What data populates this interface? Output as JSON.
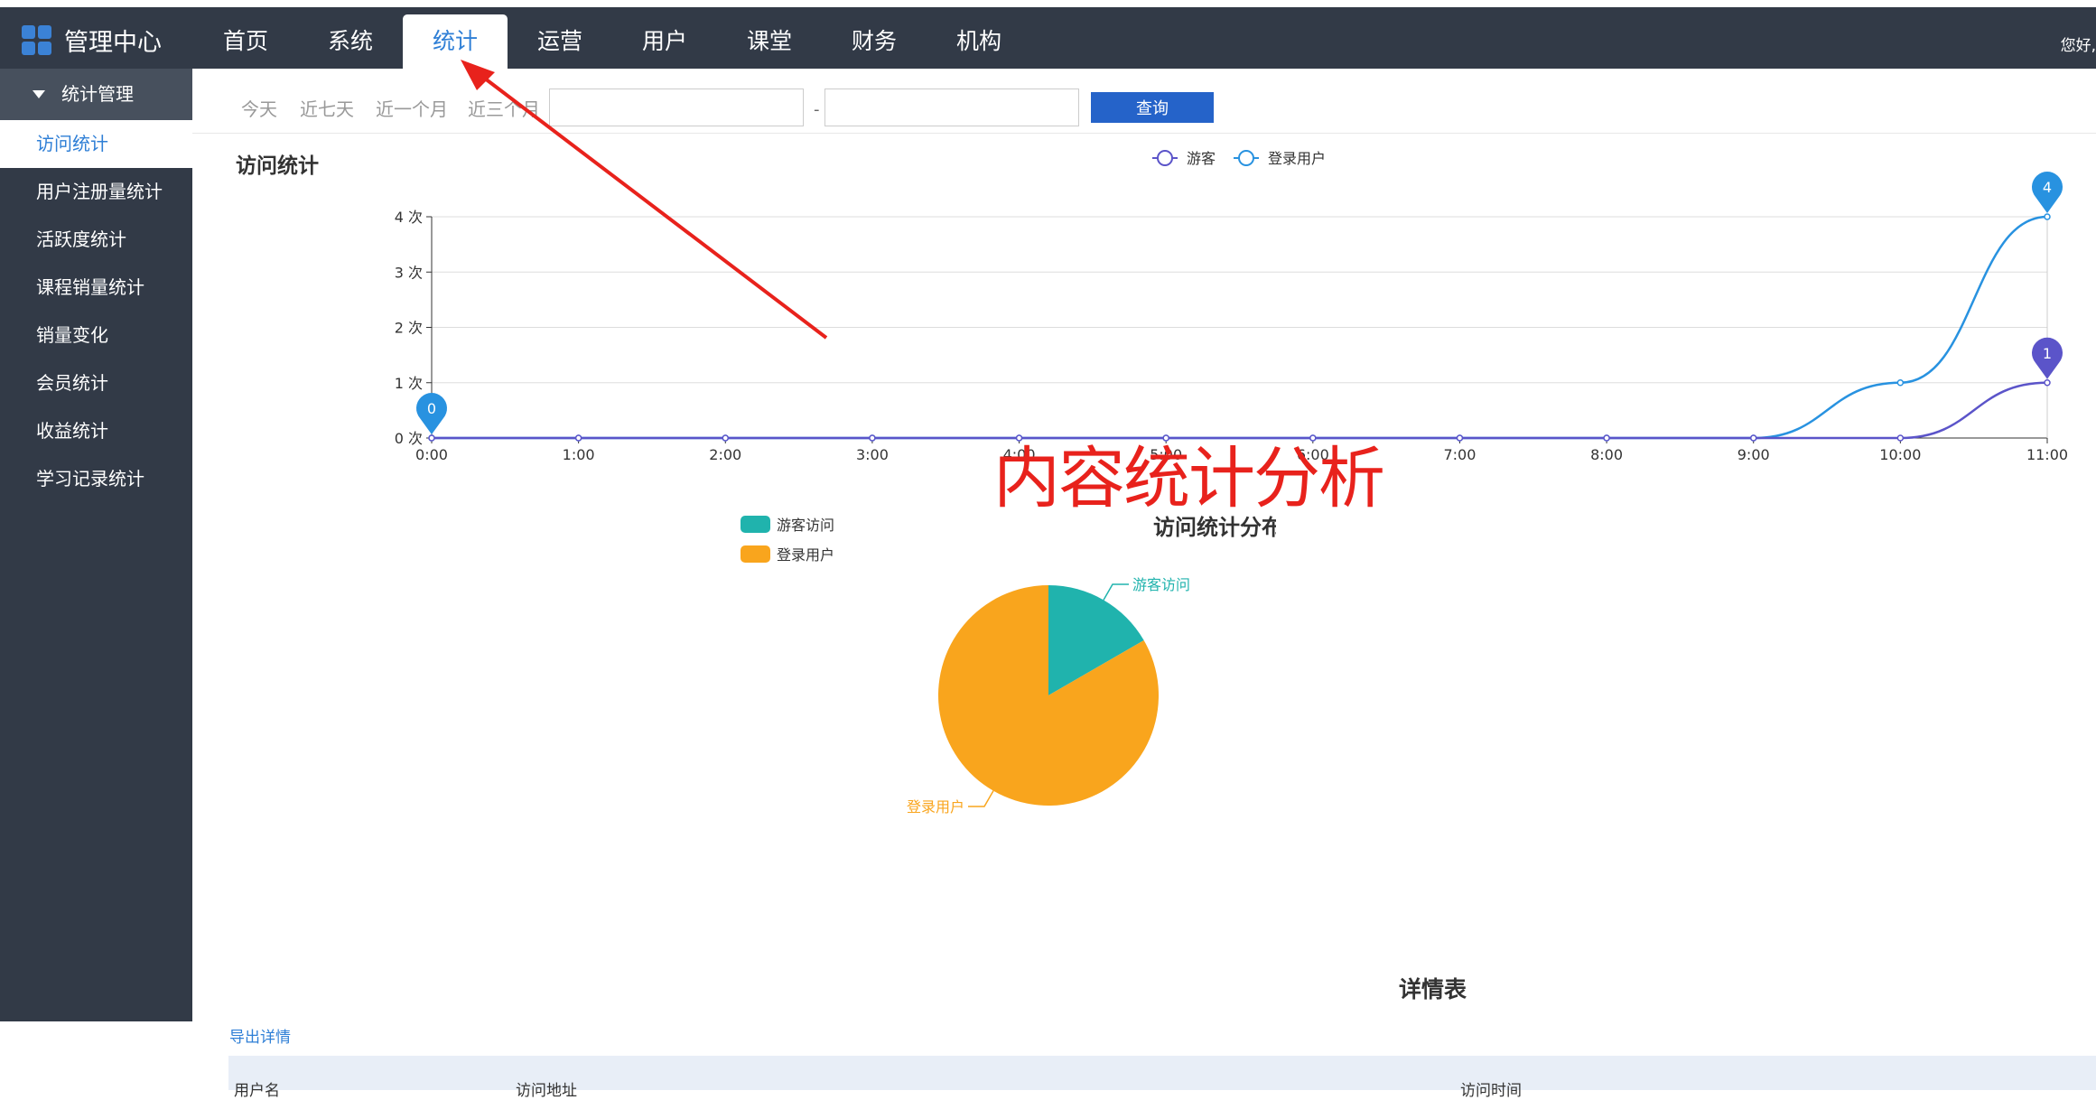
{
  "app": {
    "title": "管理中心",
    "greeting": "您好,"
  },
  "nav": [
    "首页",
    "系统",
    "统计",
    "运营",
    "用户",
    "课堂",
    "财务",
    "机构"
  ],
  "nav_active": "统计",
  "sidebar": {
    "header": "统计管理",
    "items": [
      "访问统计",
      "用户注册量统计",
      "活跃度统计",
      "课程销量统计",
      "销量变化",
      "会员统计",
      "收益统计",
      "学习记录统计"
    ],
    "active": "访问统计"
  },
  "filters": {
    "today": "今天",
    "week": "近七天",
    "month": "近一个月",
    "three_months": "近三个月",
    "separator": "-",
    "query_button": "查询"
  },
  "section_title": "访问统计",
  "annotation": "内容统计分析",
  "chart_data": [
    {
      "type": "line",
      "title": "",
      "x": [
        "0:00",
        "1:00",
        "2:00",
        "3:00",
        "4:00",
        "5:00",
        "6:00",
        "7:00",
        "8:00",
        "9:00",
        "10:00",
        "11:00"
      ],
      "y_ticks": [
        "0 次",
        "1 次",
        "2 次",
        "3 次",
        "4 次"
      ],
      "ylim": [
        0,
        4
      ],
      "legend_position": "top-center",
      "series": [
        {
          "name": "游客",
          "color": "#5b54c9",
          "values": [
            0,
            0,
            0,
            0,
            0,
            0,
            0,
            0,
            0,
            0,
            0,
            1
          ],
          "markers": [
            {
              "index": 11,
              "label": "1"
            }
          ]
        },
        {
          "name": "登录用户",
          "color": "#2892e0",
          "values": [
            0,
            0,
            0,
            0,
            0,
            0,
            0,
            0,
            0,
            0,
            1,
            4
          ],
          "markers": [
            {
              "index": 0,
              "label": "0"
            },
            {
              "index": 11,
              "label": "4"
            }
          ]
        }
      ]
    },
    {
      "type": "pie",
      "title": "访问统计分布情况",
      "legend_position": "top-left",
      "series": [
        {
          "name": "游客访问",
          "color": "#20b3ad",
          "value": 1
        },
        {
          "name": "登录用户",
          "color": "#f9a51d",
          "value": 5
        }
      ]
    }
  ],
  "table": {
    "title": "详情表",
    "export_label": "导出详情",
    "columns": [
      "用户名",
      "访问地址",
      "访问时间"
    ]
  }
}
